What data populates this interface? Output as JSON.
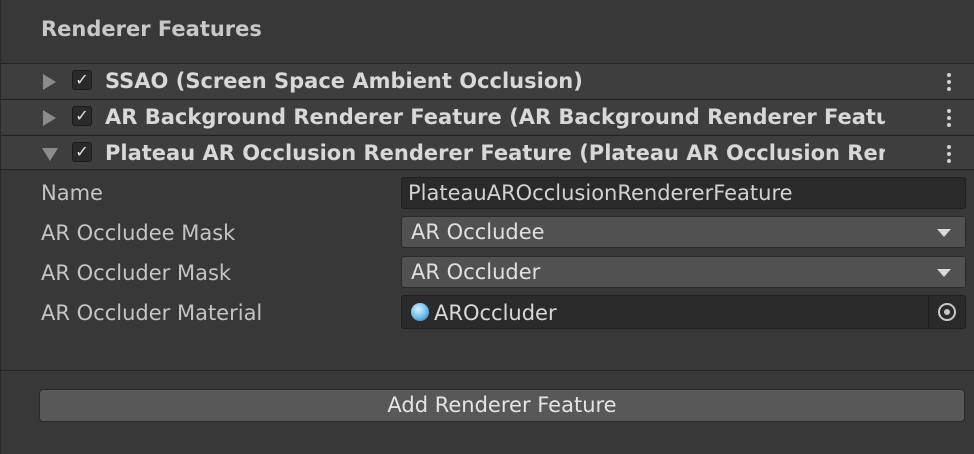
{
  "section": {
    "title": "Renderer Features"
  },
  "features": [
    {
      "label": "SSAO (Screen Space Ambient Occlusion)",
      "expanded": false,
      "enabled": true,
      "check": "✓"
    },
    {
      "label": "AR Background Renderer Feature (AR Background Renderer Featur",
      "expanded": false,
      "enabled": true,
      "check": "✓"
    },
    {
      "label": "Plateau AR Occlusion Renderer Feature (Plateau AR Occlusion Renc",
      "expanded": true,
      "enabled": true,
      "check": "✓"
    }
  ],
  "properties": {
    "name": {
      "label": "Name",
      "value": "PlateauAROcclusionRendererFeature"
    },
    "occludee_mask": {
      "label": "AR Occludee Mask",
      "value": "AR Occludee"
    },
    "occluder_mask": {
      "label": "AR Occluder Mask",
      "value": "AR Occluder"
    },
    "occluder_material": {
      "label": "AR Occluder Material",
      "value": "AROccluder",
      "icon": "material-sphere-icon"
    }
  },
  "add_button": {
    "label": "Add Renderer Feature"
  },
  "icons": {
    "fold_closed": "triangle-right-icon",
    "fold_open": "triangle-down-icon",
    "menu": "kebab-menu-icon",
    "dropdown": "chevron-down-icon",
    "object_picker": "object-picker-icon"
  },
  "colors": {
    "background": "#383838",
    "header_row": "#3e3e3e",
    "field": "#2a2a2a",
    "dropdown": "#515151",
    "button": "#585858"
  }
}
